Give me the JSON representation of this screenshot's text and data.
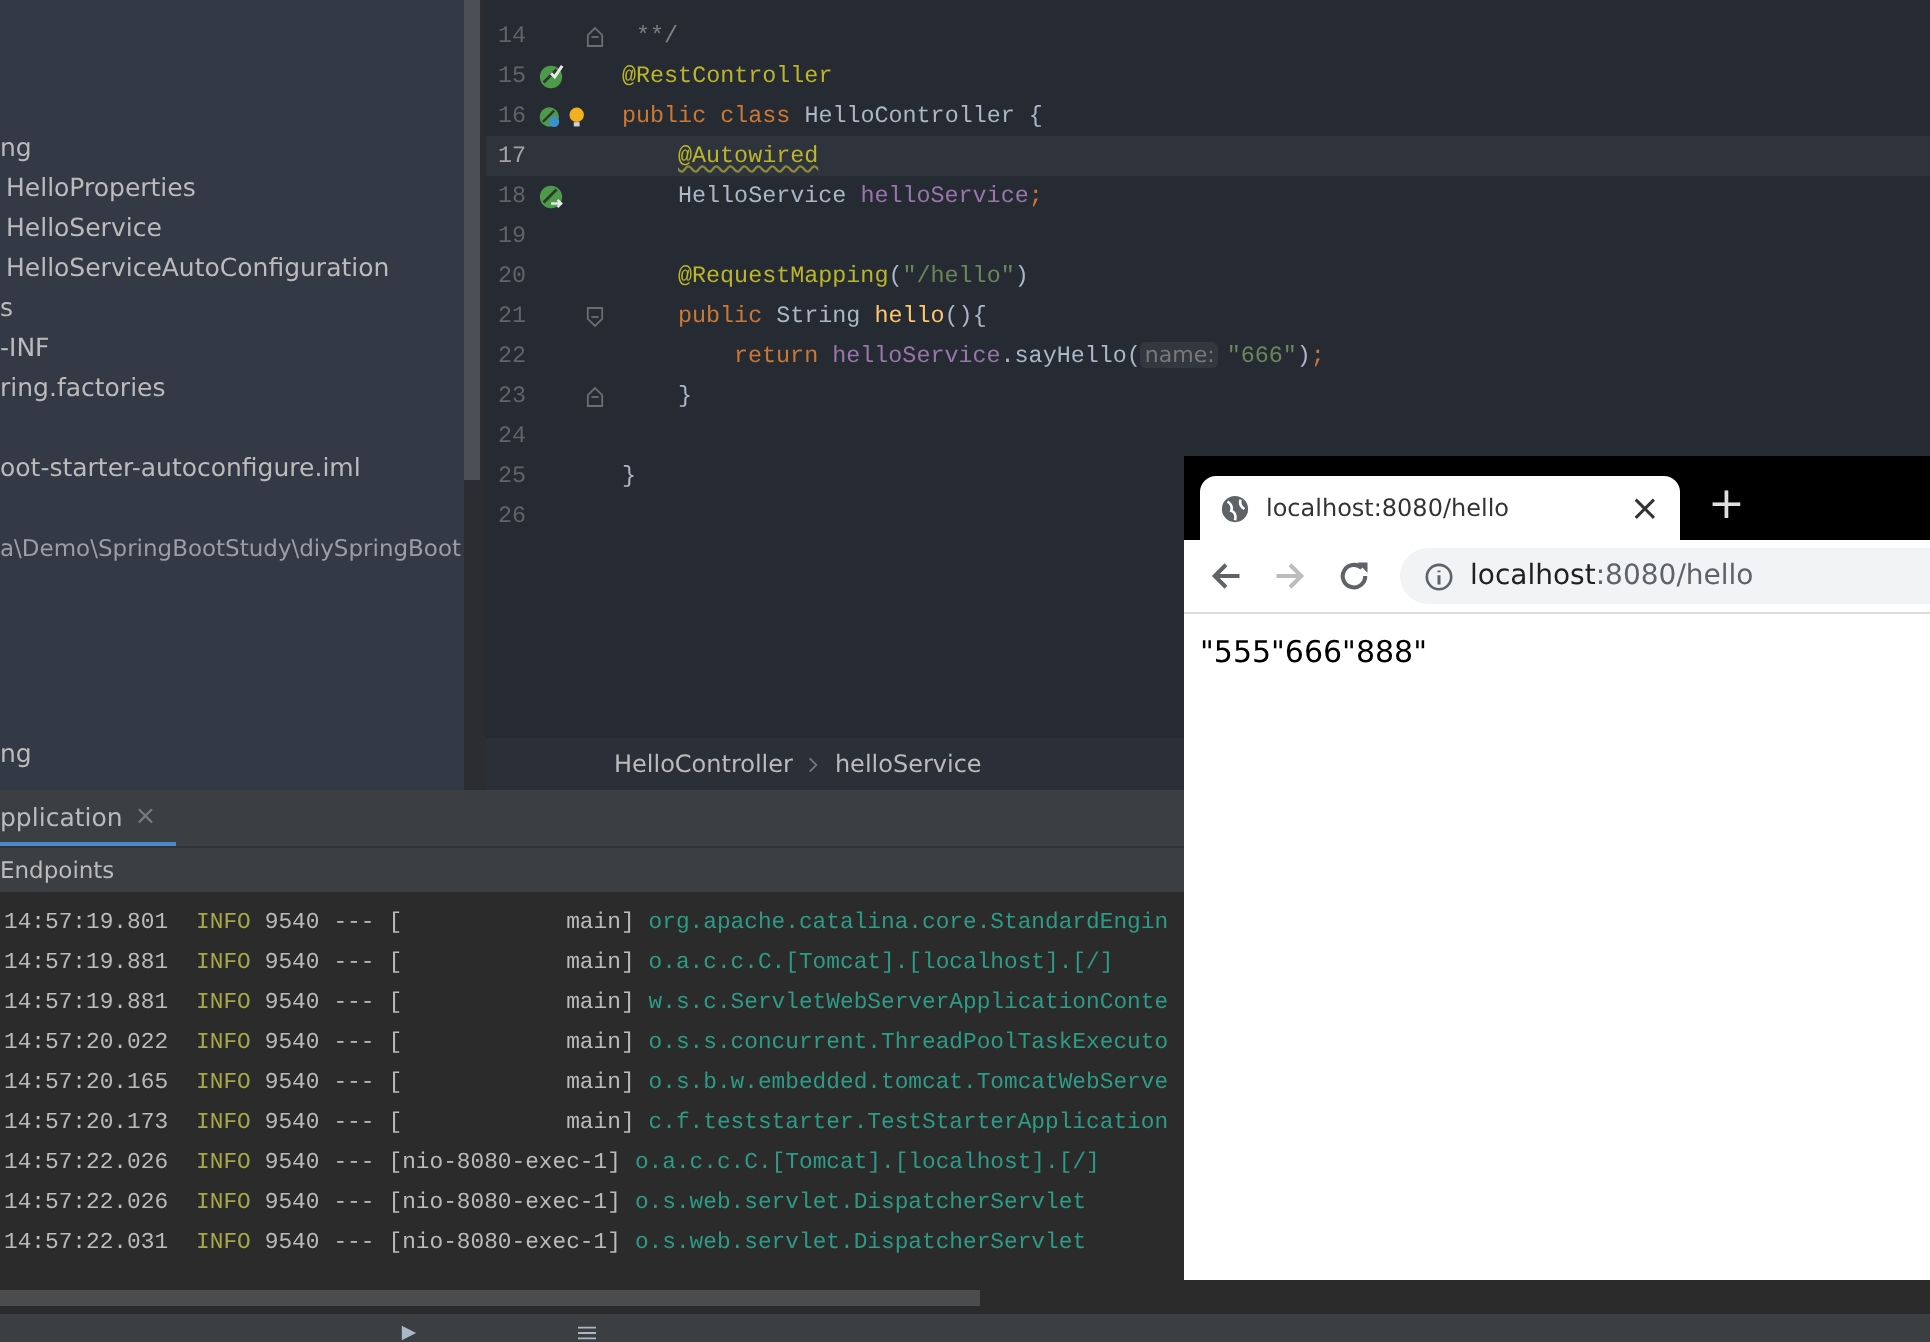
{
  "project_tree": {
    "items": [
      {
        "text": "ng",
        "kind": "package"
      },
      {
        "text": "HelloProperties",
        "kind": "class"
      },
      {
        "text": "HelloService",
        "kind": "class"
      },
      {
        "text": "HelloServiceAutoConfiguration",
        "kind": "class"
      },
      {
        "text": "s",
        "kind": "folder"
      },
      {
        "text": "-INF",
        "kind": "folder"
      },
      {
        "text": "ring.factories",
        "kind": "file"
      },
      {
        "text": "oot-starter-autoconfigure.iml",
        "kind": "file"
      }
    ],
    "path": "a\\Demo\\SpringBootStudy\\diySpringBoot",
    "bottom_item": "ng"
  },
  "editor": {
    "lines": [
      {
        "number": "14",
        "current": false,
        "fold": {
          "kind": "end"
        },
        "tokens": [
          {
            "kind": "comment",
            "text": " **/"
          }
        ]
      },
      {
        "number": "15",
        "current": false,
        "gutter_icon": {
          "kind": "bean-check"
        },
        "tokens": [
          {
            "kind": "annotation",
            "text": "@RestController"
          }
        ]
      },
      {
        "number": "16",
        "current": false,
        "gutter_icon": {
          "kind": "bean-web"
        },
        "tokens": [
          {
            "kind": "keyword",
            "text": "public class "
          },
          {
            "kind": "plain",
            "text": "HelloController {"
          }
        ],
        "children": [
          {
            "number": "17",
            "current": true,
            "tokens": [
              {
                "kind": "annotation-warn",
                "text": "@Autowired"
              }
            ]
          },
          {
            "number": "18",
            "current": false,
            "gutter_icon": {
              "kind": "bean-link"
            },
            "tokens": [
              {
                "kind": "plain",
                "text": "HelloService "
              },
              {
                "kind": "field",
                "text": "helloService"
              },
              {
                "kind": "keyword",
                "text": ";"
              }
            ]
          },
          {
            "number": "19",
            "current": false
          },
          {
            "number": "20",
            "current": false,
            "tokens": [
              {
                "kind": "annotation",
                "text": "@RequestMapping"
              },
              {
                "kind": "plain",
                "text": "("
              },
              {
                "kind": "string",
                "text": "\"/hello\""
              },
              {
                "kind": "plain",
                "text": ")"
              }
            ]
          },
          {
            "number": "21",
            "current": false,
            "fold": {
              "kind": "start"
            },
            "tokens": [
              {
                "kind": "keyword",
                "text": "public "
              },
              {
                "kind": "plain",
                "text": "String "
              },
              {
                "kind": "method",
                "text": "hello"
              },
              {
                "kind": "plain",
                "text": "(){"
              }
            ],
            "children": [
              {
                "number": "22",
                "current": false,
                "tokens": [
                  {
                    "kind": "keyword",
                    "text": "return "
                  },
                  {
                    "kind": "field",
                    "text": "helloService"
                  },
                  {
                    "kind": "plain",
                    "text": ".sayHello("
                  },
                  {
                    "kind": "hint",
                    "text": "name:"
                  },
                  {
                    "kind": "string",
                    "text": "\"666\""
                  },
                  {
                    "kind": "plain",
                    "text": ")"
                  },
                  {
                    "kind": "keyword",
                    "text": ";"
                  }
                ]
              }
            ]
          },
          {
            "number": "23",
            "current": false,
            "fold": {
              "kind": "end"
            },
            "tokens": [
              {
                "kind": "plain",
                "text": "}"
              }
            ]
          },
          {
            "number": "24",
            "current": false
          }
        ]
      },
      {
        "number": "25",
        "current": false,
        "tokens": [
          {
            "kind": "plain",
            "text": "}"
          }
        ]
      },
      {
        "number": "26",
        "current": false
      }
    ],
    "breadcrumb": [
      "HelloController",
      "helloService"
    ]
  },
  "run_panel": {
    "tab": "pplication",
    "tab_close": "×",
    "subtab": "Endpoints",
    "log": [
      {
        "time": "14:57:19.801",
        "level": "INFO",
        "pid": "9540",
        "sep": "---",
        "thread": "[            main]",
        "logger": "org.apache.catalina.core.StandardEngin"
      },
      {
        "time": "14:57:19.881",
        "level": "INFO",
        "pid": "9540",
        "sep": "---",
        "thread": "[            main]",
        "logger": "o.a.c.c.C.[Tomcat].[localhost].[/]"
      },
      {
        "time": "14:57:19.881",
        "level": "INFO",
        "pid": "9540",
        "sep": "---",
        "thread": "[            main]",
        "logger": "w.s.c.ServletWebServerApplicationConte"
      },
      {
        "time": "14:57:20.022",
        "level": "INFO",
        "pid": "9540",
        "sep": "---",
        "thread": "[            main]",
        "logger": "o.s.s.concurrent.ThreadPoolTaskExecuto"
      },
      {
        "time": "14:57:20.165",
        "level": "INFO",
        "pid": "9540",
        "sep": "---",
        "thread": "[            main]",
        "logger": "o.s.b.w.embedded.tomcat.TomcatWebServe"
      },
      {
        "time": "14:57:20.173",
        "level": "INFO",
        "pid": "9540",
        "sep": "---",
        "thread": "[            main]",
        "logger": "c.f.teststarter.TestStarterApplication"
      },
      {
        "time": "14:57:22.026",
        "level": "INFO",
        "pid": "9540",
        "sep": "---",
        "thread": "[nio-8080-exec-1]",
        "logger": "o.a.c.c.C.[Tomcat].[localhost].[/]"
      },
      {
        "time": "14:57:22.026",
        "level": "INFO",
        "pid": "9540",
        "sep": "---",
        "thread": "[nio-8080-exec-1]",
        "logger": "o.s.web.servlet.DispatcherServlet"
      },
      {
        "time": "14:57:22.031",
        "level": "INFO",
        "pid": "9540",
        "sep": "---",
        "thread": "[nio-8080-exec-1]",
        "logger": "o.s.web.servlet.DispatcherServlet"
      }
    ]
  },
  "browser": {
    "tab_title": "localhost:8080/hello",
    "tab_close": "×",
    "new_tab": "+",
    "back_disabled": false,
    "forward_disabled": true,
    "url_host": "localhost",
    "url_rest": ":8080/hello",
    "body": "\"555\"666\"888\""
  }
}
